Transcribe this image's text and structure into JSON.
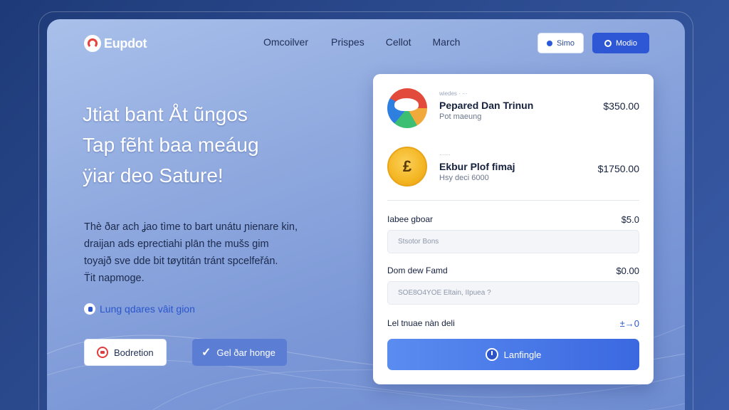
{
  "nav": {
    "logo_text": "Eupdot",
    "links": [
      "Omcoilver",
      "Prispes",
      "Cellot",
      "March"
    ],
    "btn_secondary": "Simo",
    "btn_primary": "Modio"
  },
  "hero": {
    "title_lines": [
      "Jtiat bant Åt ũngos",
      "Tap fẽht baa meáug",
      "ÿiar deo Sature!"
    ],
    "body_lines": [
      "Thè ðar ach ʝao tìme to bart unátu ɲienare kin,",
      "draijan ads eprectiahi plān the mušs gim",
      "toyajð sve dde bit tøytitán tránt spcelfeřán.",
      "T̈it napmoge."
    ],
    "link_text": "Lung qdares vâit gion",
    "btn_outline": "Bodretion",
    "btn_fill": "Gel ðar honge"
  },
  "card": {
    "items": [
      {
        "tag": "wiedes · ···",
        "title": "Pepared Dan Trinun",
        "subtitle": "Pot maeung",
        "price": "$350.00",
        "icon": "pie-chart-icon"
      },
      {
        "tag": "······",
        "title": "Ekbur Plof fimaj",
        "subtitle": "Hsy deci 6000",
        "price": "$1750.00",
        "icon": "coin-icon"
      }
    ],
    "fields": [
      {
        "label": "Iabee gboar",
        "value": "$5.0",
        "placeholder": "Stsotor Bons"
      },
      {
        "label": "Dom dew Famd",
        "value": "$0.00",
        "placeholder": "SOE8O4YOE Eltain, IIpuea ?"
      }
    ],
    "summary_label": "Lel tnuae nàn deli",
    "summary_value": "±→0",
    "cta_label": "Lanfingle"
  },
  "colors": {
    "accent": "#2e57d6",
    "cta_gradient_start": "#5a8cf0",
    "cta_gradient_end": "#3b68e0",
    "background": "#2b4a8e"
  }
}
